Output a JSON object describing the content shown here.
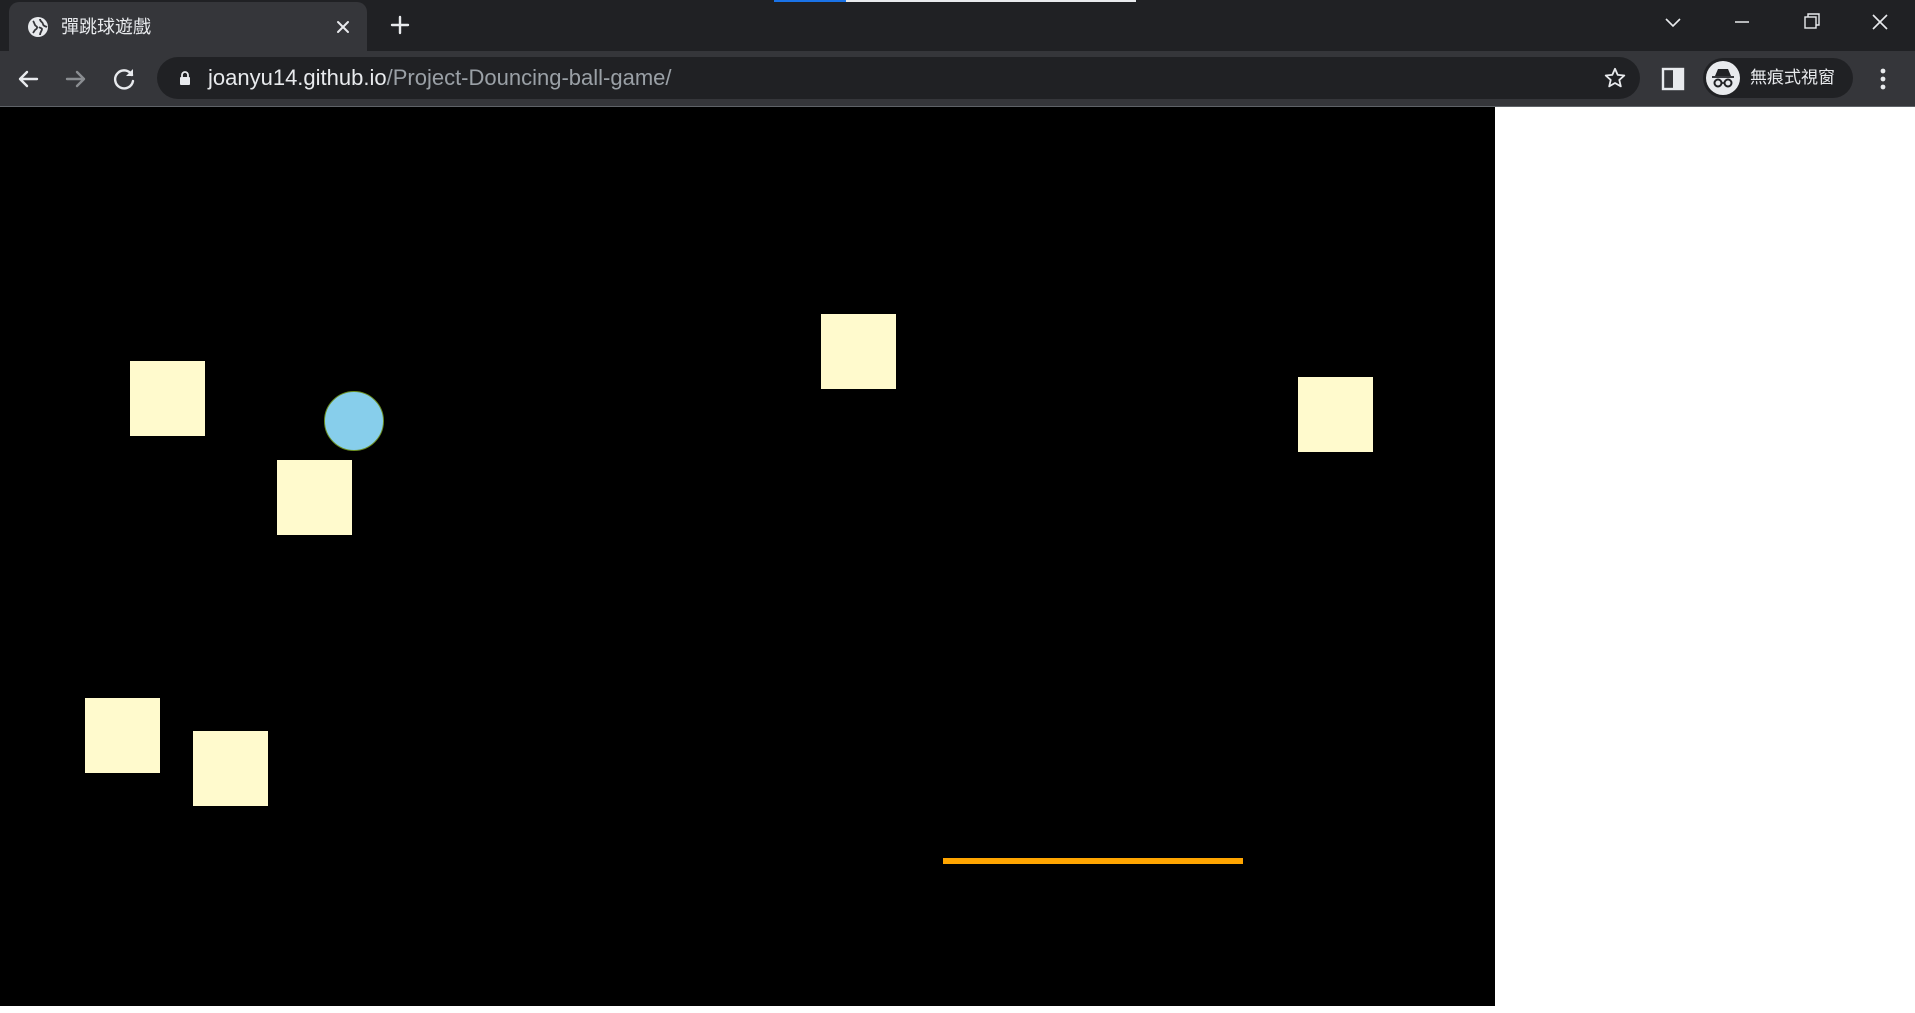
{
  "browser": {
    "tab": {
      "title": "彈跳球遊戲",
      "favicon": "globe-icon",
      "close_icon": "close-icon"
    },
    "new_tab_icon": "plus-icon",
    "window_controls": [
      "chevron-down-icon",
      "minimize-icon",
      "restore-icon",
      "close-icon"
    ],
    "nav": [
      "back-arrow-icon",
      "forward-arrow-icon",
      "reload-icon"
    ],
    "address": {
      "host": "joanyu14.github.io",
      "path": "/Project-Douncing-ball-game/",
      "lock_icon": "lock-icon",
      "bookmark_icon": "star-icon"
    },
    "side_panel_icon": "side-panel-icon",
    "incognito": {
      "label": "無痕式視窗",
      "icon": "incognito-icon"
    },
    "menu_icon": "kebab-menu-icon"
  },
  "game": {
    "background": "#000000",
    "brick_color": "#fffacd",
    "ball_color": "#87ceeb",
    "ball_border_color": "#6b8e23",
    "paddle_color": "#ffa500",
    "brick_count": 6,
    "ball_count": 1,
    "paddle_count": 1
  }
}
